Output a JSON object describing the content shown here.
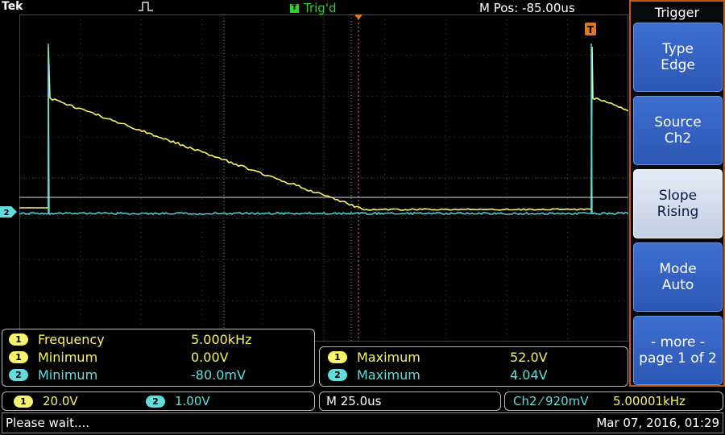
{
  "header": {
    "brand": "Tek",
    "acquisition_icon": "pulse-icon",
    "trigger_status_letter": "T",
    "trigger_status": "Trig'd",
    "horizontal_position": "M Pos: -85.00us"
  },
  "waveform": {
    "trigger_marker_letter": "T",
    "ch2_marker_label": "2",
    "channel1_color": "#f7f36c",
    "channel2_color": "#63dcdc"
  },
  "measurements": {
    "left": [
      {
        "channel": "1",
        "name": "Frequency",
        "value": "5.000kHz"
      },
      {
        "channel": "1",
        "name": "Minimum",
        "value": "0.00V"
      },
      {
        "channel": "2",
        "name": "Minimum",
        "value": "-80.0mV"
      }
    ],
    "right": [
      {
        "channel": "1",
        "name": "Maximum",
        "value": "52.0V"
      },
      {
        "channel": "2",
        "name": "Maximum",
        "value": "4.04V"
      }
    ]
  },
  "status": {
    "ch1_badge": "1",
    "ch1_scale": "20.0V",
    "ch2_badge": "2",
    "ch2_scale": "1.00V",
    "timebase": "M 25.0us",
    "trigger_source": "Ch2",
    "trigger_slope_symbol": "⁄",
    "trigger_level": "920mV",
    "trigger_frequency": "5.00001kHz"
  },
  "message": {
    "text": "Please wait....",
    "datetime": "Mar 07, 2016, 01:29"
  },
  "menu": {
    "title": "Trigger",
    "buttons": [
      {
        "line1": "Type",
        "line2": "Edge"
      },
      {
        "line1": "Source",
        "line2": "Ch2"
      },
      {
        "line1": "Slope",
        "line2": "Rising"
      },
      {
        "line1": "Mode",
        "line2": "Auto"
      },
      {
        "line1": "- more -",
        "line2": "page 1 of 2"
      }
    ]
  },
  "colors": {
    "menu_border": "#bb5a1c",
    "menu_button": "#3e6fd0",
    "trig_status": "#2fd12f",
    "trigger_marker": "#e0781e"
  }
}
